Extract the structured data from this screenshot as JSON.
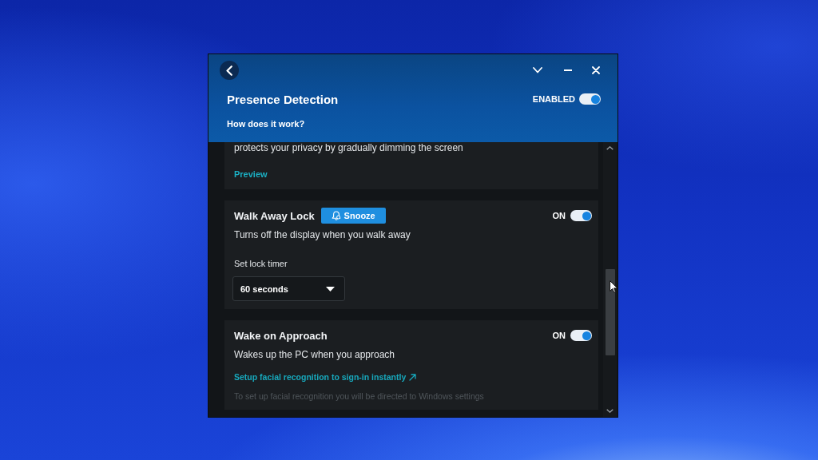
{
  "window": {
    "title": "Presence Detection",
    "status_label": "ENABLED",
    "enabled": true,
    "help_link": "How does it work?"
  },
  "sections": [
    {
      "kind": "intro",
      "description": "protects your privacy by gradually dimming the screen",
      "link": "Preview"
    },
    {
      "kind": "setting",
      "title": "Walk Away Lock",
      "button": "Snooze",
      "status_label": "ON",
      "on": true,
      "description": "Turns off the display when you walk away",
      "timer": {
        "label": "Set lock timer",
        "value": "60 seconds"
      }
    },
    {
      "kind": "setting",
      "title": "Wake on Approach",
      "status_label": "ON",
      "on": true,
      "description": "Wakes up the PC when you approach",
      "link": "Setup facial recognition to sign-in instantly",
      "note": "To set up facial recognition you will be directed to Windows settings"
    }
  ]
}
